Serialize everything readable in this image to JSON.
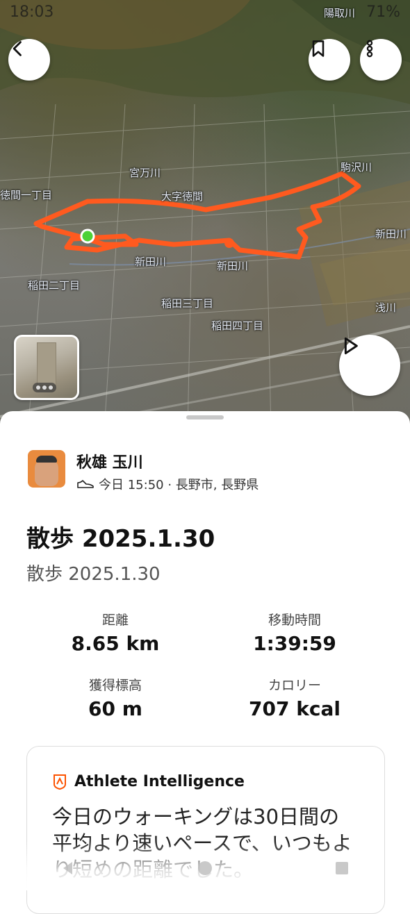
{
  "status_bar": {
    "time": "18:03",
    "battery": "71%"
  },
  "map": {
    "labels": [
      {
        "text": "陽取川"
      },
      {
        "text": "宮万川"
      },
      {
        "text": "駒沢川"
      },
      {
        "text": "徳間一丁目"
      },
      {
        "text": "大字徳間"
      },
      {
        "text": "新田川"
      },
      {
        "text": "新田川"
      },
      {
        "text": "新田川"
      },
      {
        "text": "稲田二丁目"
      },
      {
        "text": "稲田三丁目"
      },
      {
        "text": "稲田四丁目"
      },
      {
        "text": "浅川"
      }
    ],
    "route_color": "#ff5a1f",
    "start_color": "#4cd137"
  },
  "icons": {
    "back": "chevron-left-icon",
    "bookmark": "bookmark-icon",
    "more": "more-vertical-icon",
    "play": "play-icon",
    "shoe": "shoe-icon",
    "ai": "athlete-intelligence-icon"
  },
  "activity": {
    "athlete_name": "秋雄 玉川",
    "meta": "今日 15:50 · 長野市, 長野県",
    "title": "散歩 2025.1.30",
    "subtitle": "散歩 2025.1.30",
    "stats": [
      {
        "label": "距離",
        "value": "8.65 km"
      },
      {
        "label": "移動時間",
        "value": "1:39:59"
      },
      {
        "label": "獲得標高",
        "value": "60 m"
      },
      {
        "label": "カロリー",
        "value": "707 kcal"
      }
    ]
  },
  "athlete_intelligence": {
    "heading": "Athlete Intelligence",
    "text": "今日のウォーキングは30日間の平均より速いペースで、いつもより短めの距離でした。",
    "accent": "#fc5200"
  }
}
